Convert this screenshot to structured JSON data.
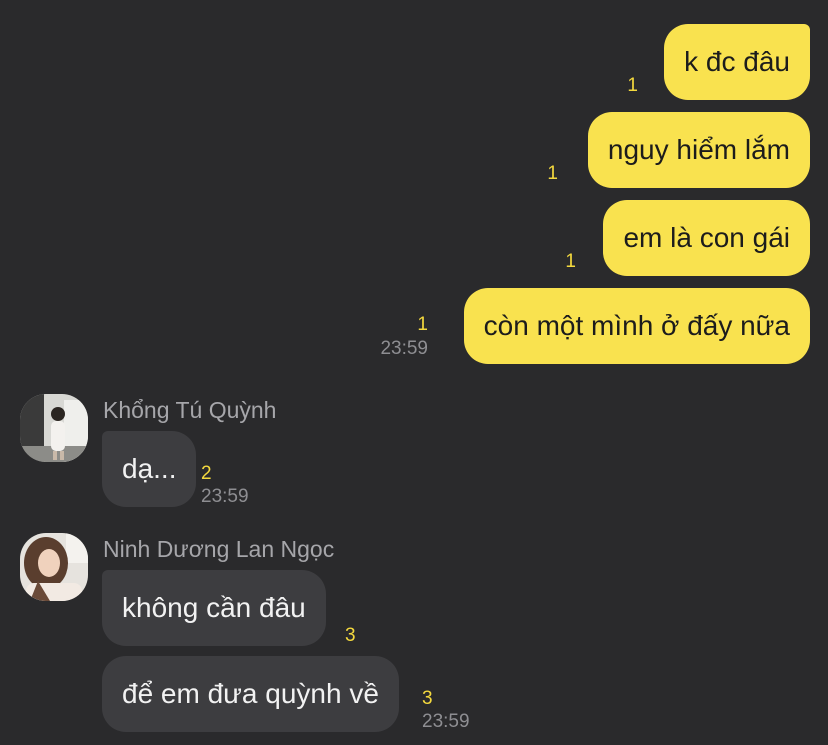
{
  "colors": {
    "background": "#2a2a2c",
    "outgoing_bubble": "#f9e24f",
    "incoming_bubble": "#3d3d40",
    "unread_count": "#f4d93e",
    "timestamp": "#8e8e92",
    "sender_name": "#a6a6aa"
  },
  "outgoing": [
    {
      "text": "k đc đâu",
      "unread": "1"
    },
    {
      "text": "nguy hiểm lắm",
      "unread": "1"
    },
    {
      "text": "em là con gái",
      "unread": "1"
    },
    {
      "text": "còn một mình ở đấy nữa",
      "unread": "1",
      "time": "23:59"
    }
  ],
  "incoming_groups": [
    {
      "sender": "Khổng Tú Quỳnh",
      "avatar_icon": "profile-photo",
      "messages": [
        {
          "text": "dạ...",
          "unread": "2",
          "time": "23:59"
        }
      ]
    },
    {
      "sender": "Ninh Dương Lan Ngọc",
      "avatar_icon": "profile-photo",
      "messages": [
        {
          "text": "không cần đâu",
          "unread": "3"
        },
        {
          "text": "để em đưa quỳnh về",
          "unread": "3",
          "time": "23:59"
        }
      ]
    }
  ]
}
